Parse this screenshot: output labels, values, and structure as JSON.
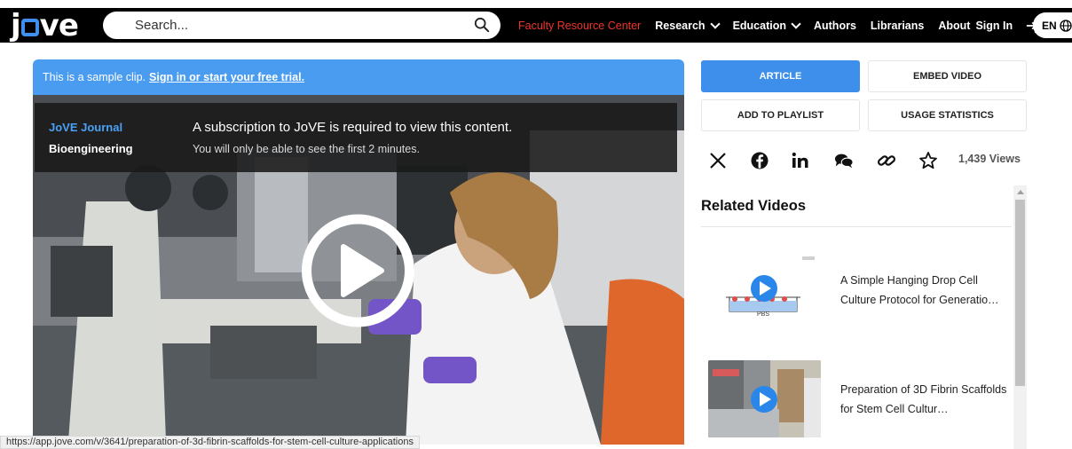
{
  "nav": {
    "logo_pre": "j",
    "logo_post": "ve",
    "search_placeholder": "Search...",
    "links": [
      {
        "label": "Faculty Resource Center",
        "highlight": true
      },
      {
        "label": "Research",
        "dropdown": true
      },
      {
        "label": "Education",
        "dropdown": true
      },
      {
        "label": "Authors"
      },
      {
        "label": "Librarians"
      },
      {
        "label": "About"
      },
      {
        "label": "Sign In"
      }
    ],
    "lang": "EN"
  },
  "video": {
    "sample_text": "This is a sample clip.",
    "sample_link": "Sign in or start your free trial.",
    "journal": "JoVE Journal",
    "section": "Bioengineering",
    "subscription_text": "A subscription to JoVE is required to view this content.",
    "preview_note": "You will only be able to see the first 2 minutes."
  },
  "actions": {
    "article": "ARTICLE",
    "embed": "EMBED VIDEO",
    "playlist": "ADD TO PLAYLIST",
    "usage": "USAGE STATISTICS"
  },
  "social": {
    "icons": [
      "x-icon",
      "facebook-icon",
      "linkedin-icon",
      "comments-icon",
      "link-icon",
      "star-icon"
    ],
    "views": "1,439 Views"
  },
  "related": {
    "title": "Related Videos",
    "items": [
      {
        "title": "A Simple Hanging Drop Cell Culture Protocol for Generatio…",
        "thumb_label": "PBS"
      },
      {
        "title": "Preparation of 3D Fibrin Scaffolds for Stem Cell Cultur…"
      }
    ]
  },
  "status_url": "https://app.jove.com/v/3641/preparation-of-3d-fibrin-scaffolds-for-stem-cell-culture-applications",
  "colors": {
    "accent": "#3e8fec",
    "sample_bar": "#4a9cf0",
    "highlight_link": "#f0342c"
  }
}
